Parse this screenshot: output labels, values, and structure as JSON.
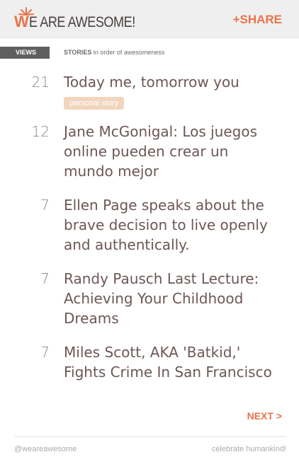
{
  "header": {
    "logo_w": "W",
    "logo_rest": "E ARE AWESOME!",
    "share_label": "+SHARE"
  },
  "columns": {
    "views_label": "VIEWS",
    "stories_bold": "STORIES",
    "stories_rest": " in order of awesomeness"
  },
  "stories": [
    {
      "count": "21",
      "title": "Today me, tomorrow you",
      "tag": "personal story"
    },
    {
      "count": "12",
      "title": "Jane McGonigal: Los juegos online pueden crear un mundo mejor"
    },
    {
      "count": "7",
      "title": "Ellen Page speaks about the brave decision to live openly and authentically."
    },
    {
      "count": "7",
      "title": "Randy Pausch Last Lecture: Achieving Your Childhood Dreams"
    },
    {
      "count": "7",
      "title": "Miles Scott, AKA 'Batkid,' Fights Crime In San Francisco"
    }
  ],
  "pagination": {
    "next_label": "NEXT >"
  },
  "footer": {
    "handle": "@weareawesome",
    "tagline": "celebrate humankind!"
  },
  "colors": {
    "accent": "#e8734a",
    "tag_bg": "#f2d5bd",
    "views_bg": "#5f5f5f"
  }
}
